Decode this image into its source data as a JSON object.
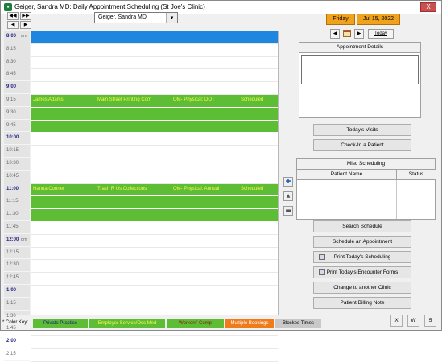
{
  "window": {
    "title": "Geiger, Sandra  MD: Daily Appointment Scheduling (St Joe's Clinic)",
    "close_label": "X"
  },
  "nav": {
    "prev_week": "◀◀",
    "next_week": "▶▶",
    "prev_day": "◀",
    "next_day": "▶"
  },
  "provider": {
    "selected": "Geiger, Sandra  MD"
  },
  "times": [
    {
      "label": "8:00",
      "ampm": "am",
      "hour": true
    },
    {
      "label": "8:15",
      "ampm": "",
      "hour": false
    },
    {
      "label": "8:30",
      "ampm": "",
      "hour": false
    },
    {
      "label": "8:45",
      "ampm": "",
      "hour": false
    },
    {
      "label": "9:00",
      "ampm": "",
      "hour": true
    },
    {
      "label": "9:15",
      "ampm": "",
      "hour": false
    },
    {
      "label": "9:30",
      "ampm": "",
      "hour": false
    },
    {
      "label": "9:45",
      "ampm": "",
      "hour": false
    },
    {
      "label": "10:00",
      "ampm": "",
      "hour": true
    },
    {
      "label": "10:15",
      "ampm": "",
      "hour": false
    },
    {
      "label": "10:30",
      "ampm": "",
      "hour": false
    },
    {
      "label": "10:45",
      "ampm": "",
      "hour": false
    },
    {
      "label": "11:00",
      "ampm": "",
      "hour": true
    },
    {
      "label": "11:15",
      "ampm": "",
      "hour": false
    },
    {
      "label": "11:30",
      "ampm": "",
      "hour": false
    },
    {
      "label": "11:45",
      "ampm": "",
      "hour": false
    },
    {
      "label": "12:00",
      "ampm": "pm",
      "hour": true
    },
    {
      "label": "12:15",
      "ampm": "",
      "hour": false
    },
    {
      "label": "12:30",
      "ampm": "",
      "hour": false
    },
    {
      "label": "12:45",
      "ampm": "",
      "hour": false
    },
    {
      "label": "1:00",
      "ampm": "",
      "hour": true
    },
    {
      "label": "1:15",
      "ampm": "",
      "hour": false
    },
    {
      "label": "1:30",
      "ampm": "",
      "hour": false
    },
    {
      "label": "1:45",
      "ampm": "",
      "hour": false
    },
    {
      "label": "2:00",
      "ampm": "",
      "hour": true
    },
    {
      "label": "2:15",
      "ampm": "",
      "hour": false
    }
  ],
  "appointments": [
    {
      "slot": "9:15",
      "patient": "James Adams",
      "employer": "Main Street Printing Com",
      "type": "OM- Physical: DOT",
      "status": "Scheduled"
    },
    {
      "slot": "11:00",
      "patient": "Hanna Conner",
      "employer": "Trash R Us Collections",
      "type": "OM- Physical: Annual",
      "status": "Scheduled"
    }
  ],
  "header": {
    "day": "Friday",
    "date": "Jul 15, 2022",
    "today_label": "Today"
  },
  "panels": {
    "appointment_details": "Appointment Details",
    "misc_scheduling": "Misc Scheduling",
    "patient_name_col": "Patient Name",
    "status_col": "Status"
  },
  "buttons": {
    "todays_visits": "Today's Visits",
    "check_in": "Check-In a Patient",
    "search_schedule": "Search Schedule",
    "schedule_appointment": "Schedule an Appointment",
    "print_scheduling": "Print Today's Scheduling",
    "print_encounter": "Print Today's Encounter Forms",
    "change_clinic": "Change to another Clinic",
    "billing_note": "Patient Billing Note"
  },
  "color_key": {
    "label": "* Color Key:",
    "items": [
      {
        "label": "Private Practice",
        "bg": "#5dbd34",
        "fg": "#1a1a8a"
      },
      {
        "label": "Employer Service/Occ Med",
        "bg": "#5dbd34",
        "fg": "#f7f74c"
      },
      {
        "label": "Workers' Comp",
        "bg": "#5dbd34",
        "fg": "#8a1a1a"
      },
      {
        "label": "Multiple Bookings",
        "bg": "#f07b1a",
        "fg": "#ffffff"
      },
      {
        "label": "Blocked Times",
        "bg": "#c8c8c8",
        "fg": "#000000"
      }
    ]
  },
  "letter_buttons": [
    "X",
    "W",
    "5"
  ],
  "colors": {
    "selected_row": "#1f86e0",
    "appointment_green": "#5dbd34",
    "date_orange": "#f0a21a"
  }
}
